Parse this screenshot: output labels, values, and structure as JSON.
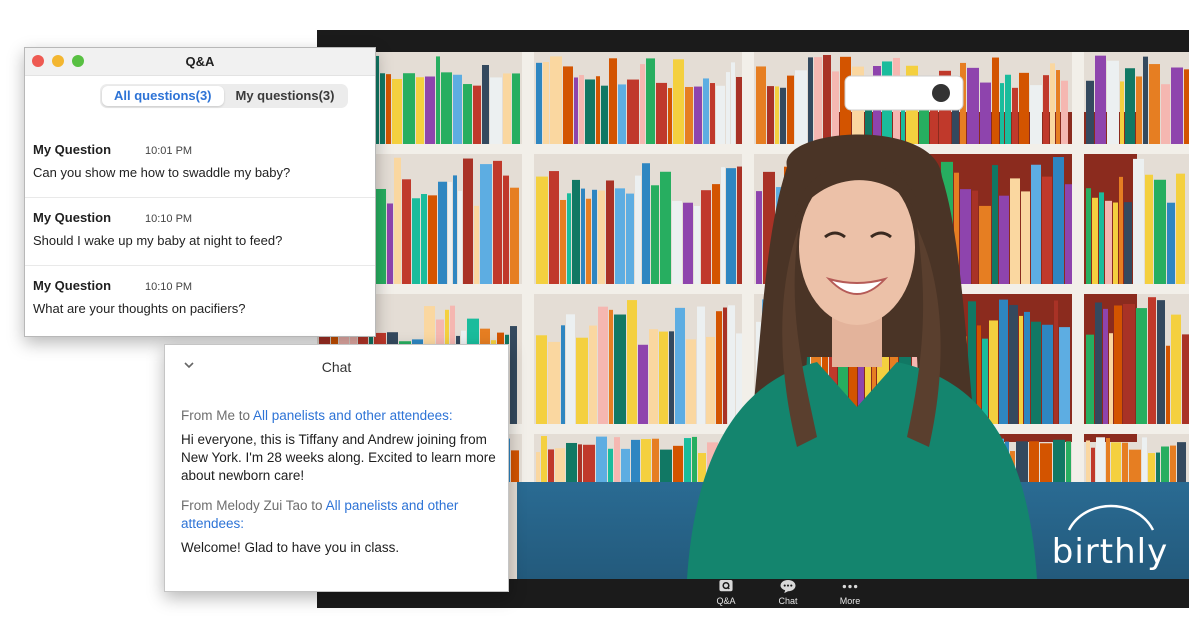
{
  "qa": {
    "title": "Q&A",
    "tabs": [
      {
        "label": "All questions(3)",
        "active": true
      },
      {
        "label": "My questions(3)",
        "active": false
      }
    ],
    "questions": [
      {
        "author": "My Question",
        "time": "10:01 PM",
        "text": "Can you show me how to swaddle my baby?"
      },
      {
        "author": "My Question",
        "time": "10:10 PM",
        "text": "Should I wake up my baby at night to feed?"
      },
      {
        "author": "My Question",
        "time": "10:10 PM",
        "text": "What are your thoughts on pacifiers?"
      }
    ]
  },
  "chat": {
    "title": "Chat",
    "messages": [
      {
        "from_prefix": "From Me to ",
        "to": "All panelists and other attendees:",
        "text": "Hi everyone, this is Tiffany and Andrew joining from New York. I'm 28 weeks along. Excited to learn more about newborn care!"
      },
      {
        "from_prefix": "From Melody Zui Tao to ",
        "to": "All panelists and other attendees:",
        "text": "Welcome! Glad to have you in class."
      }
    ]
  },
  "video": {
    "logo_text": "birthly",
    "controls": [
      {
        "label": "Q&A",
        "icon": "qa-icon"
      },
      {
        "label": "Chat",
        "icon": "chat-icon"
      },
      {
        "label": "More",
        "icon": "more-icon"
      }
    ]
  },
  "colors": {
    "accent": "#2d73d6",
    "close": "#ee5a52",
    "minimize": "#f3b630",
    "zoom": "#58c042",
    "sofa": "#2a6b93",
    "shirt": "#14856e",
    "control_bar": "#1b1b1b"
  }
}
